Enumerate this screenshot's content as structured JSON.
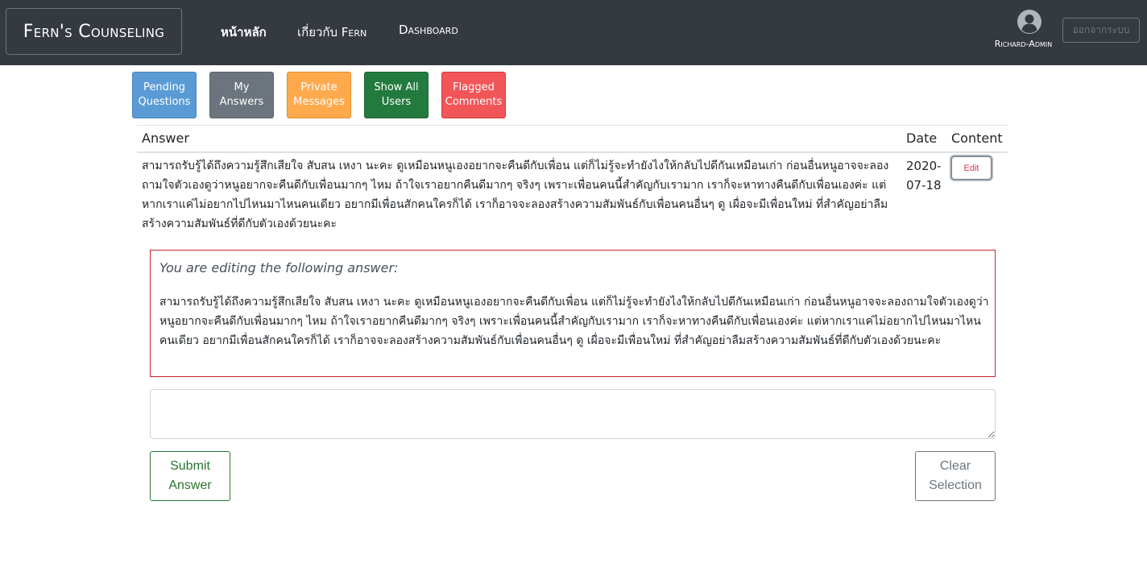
{
  "navbar": {
    "brand": "Fern's Counseling",
    "links": [
      "หน้าหลัก",
      "เกี่ยวกับ Fern",
      "Dashboard"
    ],
    "user": {
      "icon": "user-circle-icon",
      "name": "Richard-Admin"
    },
    "logout_label": "ออกจากระบบ"
  },
  "tabs": [
    {
      "label": "Pending Questions",
      "color": "#5b9bd5"
    },
    {
      "label": "My Answers",
      "color": "#6c757d"
    },
    {
      "label": "Private Messages",
      "color": "#ffa94d"
    },
    {
      "label": "Show All Users",
      "color": "#237a3e"
    },
    {
      "label": "Flagged Comments",
      "color": "#f25558"
    }
  ],
  "table": {
    "headers": [
      "Answer",
      "Date",
      "Content"
    ],
    "rows": [
      {
        "answer": "สามารถรับรู้ได้ถึงความรู้สึกเสียใจ สับสน เหงา นะคะ ดูเหมือนหนูเองอยากจะคืนดีกับเพื่อน แต่ก็ไม่รู้จะทำยังไงให้กลับไปดีกันเหมือนเก่า ก่อนอื่นหนูอาจจะลองถามใจตัวเองดูว่าหนูอยากจะคืนดีกับเพื่อนมากๆ ไหม ถ้าใจเราอยากคืนดีมากๆ จริงๆ เพราะเพื่อนคนนี้สำคัญกับเรามาก เราก็จะหาทางคืนดีกับเพื่อนเองค่ะ แต่หากเราแค่ไม่อยากไปไหนมาไหนคนเดียว อยากมีเพื่อนสักคนใครก็ได้ เราก็อาจจะลองสร้างความสัมพันธ์กับเพื่อนคนอื่นๆ ดู เผื่อจะมีเพื่อนใหม่ ที่สำคัญอย่าลืมสร้างความสัมพันธ์ที่ดีกับตัวเองด้วยนะคะ",
        "date": "2020-07-18",
        "edit_label": "Edit"
      }
    ]
  },
  "editing": {
    "intro": "You are editing the following answer:",
    "text": "สามารถรับรู้ได้ถึงความรู้สึกเสียใจ สับสน เหงา นะคะ ดูเหมือนหนูเองอยากจะคืนดีกับเพื่อน แต่ก็ไม่รู้จะทำยังไงให้กลับไปดีกันเหมือนเก่า ก่อนอื่นหนูอาจจะลองถามใจตัวเองดูว่าหนูอยากจะคืนดีกับเพื่อนมากๆ ไหม ถ้าใจเราอยากคืนดีมากๆ จริงๆ เพราะเพื่อนคนนี้สำคัญกับเรามาก เราก็จะหาทางคืนดีกับเพื่อนเองค่ะ แต่หากเราแค่ไม่อยากไปไหนมาไหนคนเดียว อยากมีเพื่อนสักคนใครก็ได้ เราก็อาจจะลองสร้างความสัมพันธ์กับเพื่อนคนอื่นๆ ดู เผื่อจะมีเพื่อนใหม่ ที่สำคัญอย่าลืมสร้างความสัมพันธ์ที่ดีกับตัวเองด้วยนะคะ",
    "textarea_value": "",
    "submit_label": "Submit Answer",
    "clear_label": "Clear Selection"
  }
}
